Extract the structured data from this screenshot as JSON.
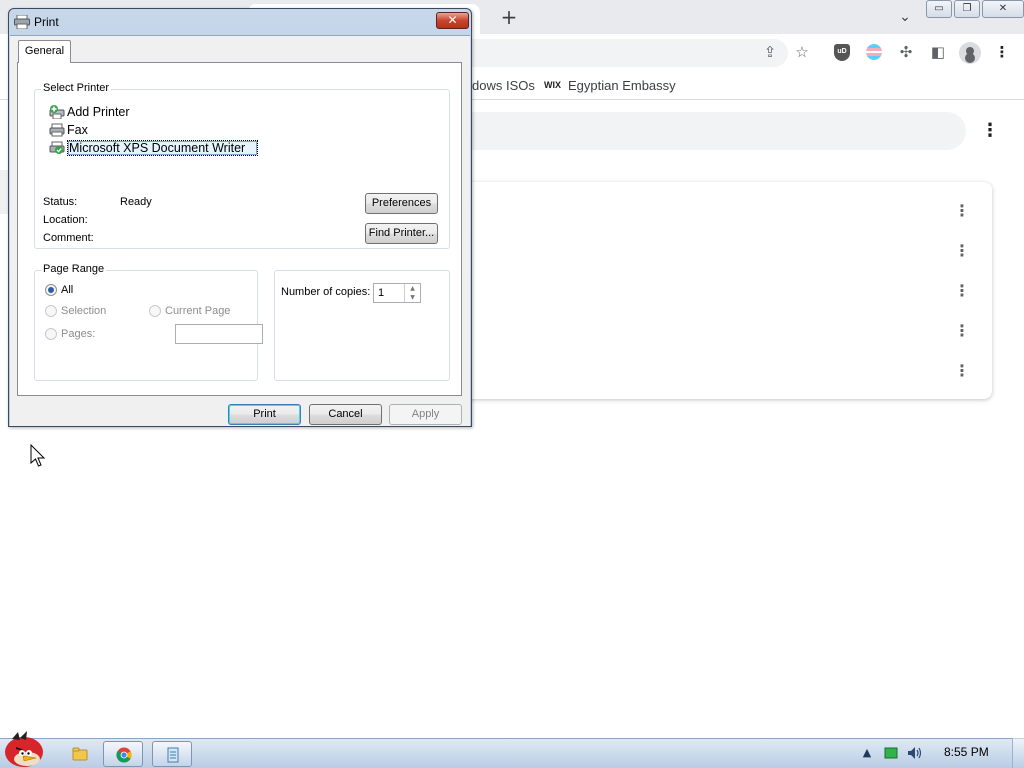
{
  "browser": {
    "new_tab_symbol": "+",
    "tab_search_symbol": "⌄",
    "window_buttons": {
      "minimize": "▭",
      "restore": "❐",
      "close": "✕"
    },
    "toolbar_icons": {
      "share": "⇪",
      "bookmark_star": "☆",
      "ublock_text": "uD",
      "extensions": "✣",
      "side_panel": "◧",
      "menu": "⋮"
    },
    "bookmarks": [
      {
        "label": "dows ISOs"
      },
      {
        "label": "Egyptian Embassy",
        "favicon_text": "WIX"
      }
    ],
    "page_menu_symbol": "⋮",
    "card_rows": [
      {
        "menu_symbol": "⋮"
      },
      {
        "menu_symbol": "⋮"
      },
      {
        "menu_symbol": "⋮"
      },
      {
        "menu_symbol": "⋮"
      },
      {
        "menu_symbol": "⋮"
      }
    ]
  },
  "dialog": {
    "title": "Print",
    "close_symbol": "✕",
    "tab_label": "General",
    "select_printer": {
      "legend": "Select Printer",
      "printers": [
        {
          "name": "Add Printer",
          "icon": "add-printer-icon",
          "selected": false
        },
        {
          "name": "Fax",
          "icon": "fax-printer-icon",
          "selected": false
        },
        {
          "name": "Microsoft XPS Document Writer",
          "icon": "xps-printer-icon",
          "selected": true
        }
      ],
      "status_label": "Status:",
      "status_value": "Ready",
      "location_label": "Location:",
      "location_value": "",
      "comment_label": "Comment:",
      "comment_value": "",
      "preferences_button": "Preferences",
      "find_printer_button": "Find Printer..."
    },
    "page_range": {
      "legend": "Page Range",
      "options": {
        "all": "All",
        "selection": "Selection",
        "current_page": "Current Page",
        "pages": "Pages:"
      },
      "selected": "all",
      "pages_value": ""
    },
    "copies": {
      "label": "Number of copies:",
      "value": "1"
    },
    "buttons": {
      "print": "Print",
      "cancel": "Cancel",
      "apply": "Apply"
    }
  },
  "taskbar": {
    "clock": "8:55 PM",
    "tray": {
      "show_hidden": "▲",
      "volume": "🕪"
    }
  },
  "colors": {
    "dialog_frame": "#b7cbe2",
    "taskbar": "#c9d9ec",
    "chrome_tabstrip": "#e8eaed",
    "selection_highlight": "#e5f3fb"
  }
}
